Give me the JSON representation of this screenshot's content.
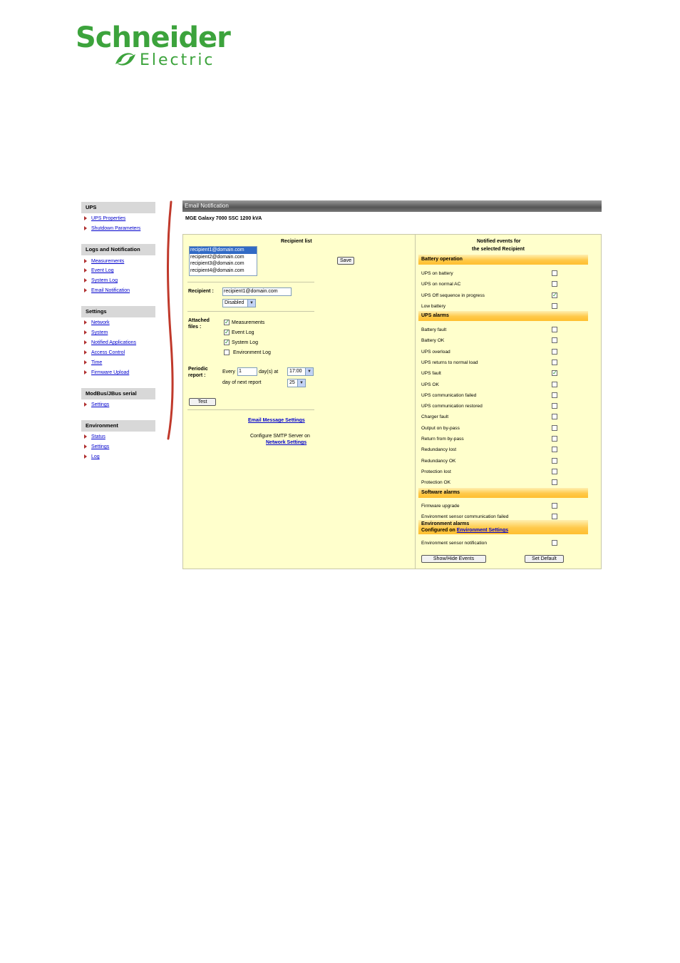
{
  "logo": {
    "line1": "Schneider",
    "line2": "Electric",
    "color": "#3ca33c"
  },
  "sidebar": {
    "groups": [
      {
        "title": "UPS",
        "items": [
          "UPS Properties",
          "Shutdown Parameters"
        ]
      },
      {
        "title": "Logs and Notification",
        "items": [
          "Measurements",
          "Event Log",
          "System Log",
          "Email Notification"
        ]
      },
      {
        "title": "Settings",
        "items": [
          "Network",
          "System",
          "Notified Applications",
          "Access Control",
          "Time",
          "Firmware Upload"
        ]
      },
      {
        "title": "ModBus/JBus serial",
        "items": [
          "Settings"
        ]
      },
      {
        "title": "Environment",
        "items": [
          "Status",
          "Settings",
          "Log"
        ]
      }
    ]
  },
  "page": {
    "title": "Email Notification",
    "device": "MGE Galaxy 7000 SSC 1200 kVA"
  },
  "left": {
    "recipient_list_title": "Recipient list",
    "recipients": [
      "recipient1@domain.com",
      "recipient2@domain.com",
      "recipient3@domain.com",
      "recipient4@domain.com"
    ],
    "save_label": "Save",
    "recipient_label": "Recipient :",
    "recipient_value": "recipient1@domain.com",
    "status_value": "Disabled",
    "attached_label_1": "Attached",
    "attached_label_2": "files :",
    "files": [
      {
        "label": "Measurements",
        "checked": true
      },
      {
        "label": "Event Log",
        "checked": true
      },
      {
        "label": "System Log",
        "checked": true
      },
      {
        "label": "Environment Log",
        "checked": false
      }
    ],
    "periodic_label_1": "Periodic",
    "periodic_label_2": "report :",
    "every_label": "Every",
    "every_value": "1",
    "days_at_label": "day(s) at",
    "time_value": "17:00",
    "next_label": "day of next report",
    "next_value": "25",
    "test_label": "Test",
    "email_msg_link": "Email Message Settings",
    "smtp_text": "Configure SMTP Server on",
    "network_link": "Network Settings"
  },
  "right": {
    "title_1": "Notified events for",
    "title_2": "the selected Recipient",
    "battery": {
      "title": "Battery operation",
      "events": [
        {
          "label": "UPS on battery",
          "checked": false
        },
        {
          "label": "UPS on normal AC",
          "checked": false
        },
        {
          "label": "UPS Off sequence in progress",
          "checked": true
        },
        {
          "label": "Low battery",
          "checked": false
        }
      ]
    },
    "alarms": {
      "title": "UPS alarms",
      "events": [
        {
          "label": "Battery fault",
          "checked": false
        },
        {
          "label": "Battery OK",
          "checked": false
        },
        {
          "label": "UPS overload",
          "checked": false
        },
        {
          "label": "UPS returns to normal load",
          "checked": false
        },
        {
          "label": "UPS fault",
          "checked": true
        },
        {
          "label": "UPS OK",
          "checked": false
        },
        {
          "label": "UPS communication failed",
          "checked": false
        },
        {
          "label": "UPS communication restored",
          "checked": false
        },
        {
          "label": "Charger fault",
          "checked": false
        },
        {
          "label": "Output on by-pass",
          "checked": false
        },
        {
          "label": "Return from by-pass",
          "checked": false
        },
        {
          "label": "Redundancy lost",
          "checked": false
        },
        {
          "label": "Redundancy OK",
          "checked": false
        },
        {
          "label": "Protection lost",
          "checked": false
        },
        {
          "label": "Protection OK",
          "checked": false
        }
      ]
    },
    "software": {
      "title": "Software alarms",
      "events": [
        {
          "label": "Firmware upgrade",
          "checked": false
        },
        {
          "label": "Environment sensor communication failed",
          "checked": false
        }
      ]
    },
    "environment": {
      "title": "Environment alarms",
      "configured_text": "Configured on",
      "configured_link": "Environment Settings",
      "events": [
        {
          "label": "Environment sensor notification",
          "checked": false
        }
      ]
    },
    "show_hide_label": "Show/Hide Events",
    "set_default_label": "Set Default"
  }
}
